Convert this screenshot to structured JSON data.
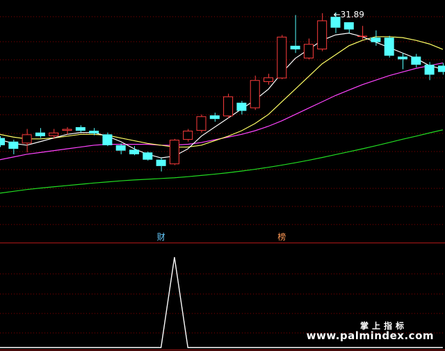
{
  "colors": {
    "background": "#000000",
    "grid": "#8b0000",
    "up_candle": "#ff3c3c",
    "down_candle": "#54ffff",
    "ma_short": "#ffffff",
    "ma_mid": "#ffff66",
    "ma_long": "#ff44ff",
    "ma_longest": "#22dd22",
    "indicator_line": "#ffffff",
    "label_blue": "#66ccff",
    "label_orange": "#ff9955"
  },
  "price_label": "31.89",
  "price_label_icon": "arrow-left-icon",
  "indicator_labels": [
    {
      "text": "财",
      "candle_index": 12,
      "color": "label_blue"
    },
    {
      "text": "榜",
      "candle_index": 21,
      "color": "label_orange"
    }
  ],
  "watermark": {
    "line1": "掌上指标",
    "line2": "www.palmindex.com"
  },
  "chart_data": {
    "type": "candlestick",
    "ylim": [
      21.5,
      32.8
    ],
    "grid": true,
    "candles": [
      {
        "o": 25.4,
        "c": 25.0,
        "h": 25.5,
        "l": 24.9
      },
      {
        "o": 25.2,
        "c": 24.8,
        "h": 25.3,
        "l": 24.5
      },
      {
        "o": 25.1,
        "c": 25.6,
        "h": 25.9,
        "l": 24.6
      },
      {
        "o": 25.7,
        "c": 25.5,
        "h": 25.95,
        "l": 25.4
      },
      {
        "o": 25.5,
        "c": 25.7,
        "h": 25.9,
        "l": 25.35
      },
      {
        "o": 25.8,
        "c": 25.9,
        "h": 26.0,
        "l": 25.6
      },
      {
        "o": 26.0,
        "c": 25.8,
        "h": 26.1,
        "l": 25.7
      },
      {
        "o": 25.8,
        "c": 25.65,
        "h": 25.95,
        "l": 25.55
      },
      {
        "o": 25.6,
        "c": 25.0,
        "h": 25.7,
        "l": 24.95
      },
      {
        "o": 25.0,
        "c": 24.7,
        "h": 25.1,
        "l": 24.5
      },
      {
        "o": 24.75,
        "c": 24.5,
        "h": 24.95,
        "l": 24.45
      },
      {
        "o": 24.6,
        "c": 24.2,
        "h": 24.65,
        "l": 24.15
      },
      {
        "o": 24.2,
        "c": 23.85,
        "h": 24.3,
        "l": 23.55
      },
      {
        "o": 23.95,
        "c": 25.3,
        "h": 25.35,
        "l": 23.9
      },
      {
        "o": 25.3,
        "c": 25.8,
        "h": 25.9,
        "l": 25.2
      },
      {
        "o": 25.8,
        "c": 26.6,
        "h": 26.7,
        "l": 25.7
      },
      {
        "o": 26.65,
        "c": 26.45,
        "h": 26.8,
        "l": 26.3
      },
      {
        "o": 26.6,
        "c": 27.7,
        "h": 27.85,
        "l": 26.5
      },
      {
        "o": 27.35,
        "c": 26.9,
        "h": 27.45,
        "l": 26.7
      },
      {
        "o": 27.05,
        "c": 28.6,
        "h": 28.85,
        "l": 26.95
      },
      {
        "o": 28.5,
        "c": 28.75,
        "h": 28.95,
        "l": 28.35
      },
      {
        "o": 28.7,
        "c": 31.0,
        "h": 31.1,
        "l": 28.65
      },
      {
        "o": 30.5,
        "c": 30.3,
        "h": 32.2,
        "l": 30.1
      },
      {
        "o": 29.8,
        "c": 30.6,
        "h": 30.9,
        "l": 29.75
      },
      {
        "o": 30.3,
        "c": 31.9,
        "h": 32.3,
        "l": 30.2
      },
      {
        "o": 32.1,
        "c": 31.5,
        "h": 32.35,
        "l": 31.2
      },
      {
        "o": 31.8,
        "c": 31.4,
        "h": 31.8,
        "l": 31.2
      },
      {
        "o": 31.0,
        "c": 31.05,
        "h": 31.6,
        "l": 30.85
      },
      {
        "o": 30.95,
        "c": 30.7,
        "h": 31.35,
        "l": 30.5
      },
      {
        "o": 30.95,
        "c": 29.95,
        "h": 31.05,
        "l": 29.85
      },
      {
        "o": 29.9,
        "c": 29.75,
        "h": 30.1,
        "l": 29.2
      },
      {
        "o": 29.9,
        "c": 29.45,
        "h": 30.05,
        "l": 29.3
      },
      {
        "o": 29.45,
        "c": 28.9,
        "h": 29.6,
        "l": 28.6
      },
      {
        "o": 29.4,
        "c": 29.05,
        "h": 29.55,
        "l": 28.9
      }
    ],
    "ma_short": [
      25.3,
      25.1,
      25.0,
      25.2,
      25.4,
      25.6,
      25.7,
      25.7,
      25.5,
      25.2,
      24.8,
      24.5,
      24.3,
      24.4,
      24.8,
      25.5,
      26.0,
      26.5,
      27.0,
      27.5,
      28.1,
      29.0,
      29.8,
      30.3,
      30.8,
      31.1,
      31.2,
      31.0,
      30.7,
      30.4,
      30.1,
      29.8,
      29.4,
      29.2
    ],
    "ma_mid": [
      25.6,
      25.45,
      25.35,
      25.35,
      25.4,
      25.5,
      25.6,
      25.6,
      25.55,
      25.4,
      25.25,
      25.1,
      25.0,
      24.9,
      24.9,
      25.0,
      25.25,
      25.5,
      25.8,
      26.2,
      26.7,
      27.4,
      28.1,
      28.8,
      29.5,
      30.0,
      30.5,
      30.8,
      31.0,
      31.0,
      30.95,
      30.8,
      30.6,
      30.3
    ],
    "ma_long": [
      24.2,
      24.35,
      24.5,
      24.6,
      24.7,
      24.8,
      24.9,
      25.0,
      25.05,
      25.05,
      25.05,
      25.05,
      25.0,
      25.0,
      25.05,
      25.15,
      25.3,
      25.45,
      25.6,
      25.8,
      26.05,
      26.35,
      26.7,
      27.05,
      27.4,
      27.75,
      28.05,
      28.35,
      28.6,
      28.85,
      29.05,
      29.25,
      29.4,
      29.55
    ],
    "ma_longest": [
      22.35,
      22.45,
      22.55,
      22.63,
      22.7,
      22.77,
      22.84,
      22.91,
      22.97,
      23.03,
      23.08,
      23.12,
      23.16,
      23.2,
      23.26,
      23.33,
      23.4,
      23.48,
      23.57,
      23.67,
      23.78,
      23.9,
      24.03,
      24.17,
      24.32,
      24.48,
      24.64,
      24.8,
      24.97,
      25.15,
      25.33,
      25.5,
      25.68,
      25.85
    ],
    "indicator": {
      "ylim": [
        0,
        140
      ],
      "values": [
        0,
        0,
        0,
        0,
        0,
        0,
        0,
        0,
        0,
        0,
        0,
        0,
        0,
        130,
        0,
        0,
        0,
        0,
        0,
        0,
        0,
        0,
        0,
        0,
        0,
        0,
        0,
        0,
        0,
        0,
        0,
        0,
        0,
        0
      ]
    }
  }
}
